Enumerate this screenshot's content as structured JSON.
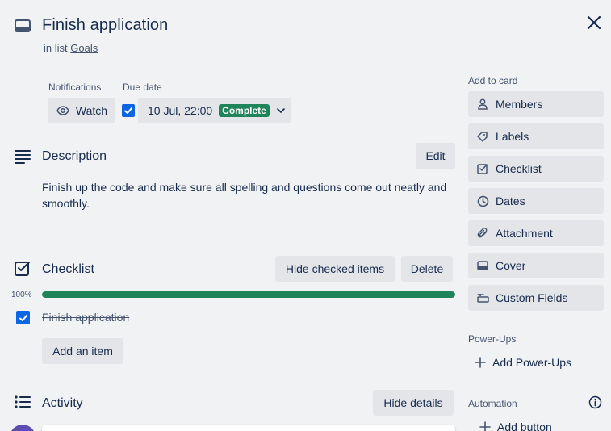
{
  "card": {
    "title": "Finish application",
    "in_list_prefix": "in list",
    "list_name": "Goals"
  },
  "notifications": {
    "label": "Notifications",
    "watch_label": "Watch"
  },
  "due_date": {
    "label": "Due date",
    "checked": true,
    "value": "10 Jul, 22:00",
    "status": "Complete",
    "status_color": "#1f845a"
  },
  "description": {
    "title": "Description",
    "edit_label": "Edit",
    "text": "Finish up the code and make sure all spelling and questions come out neatly and smoothly."
  },
  "checklist": {
    "title": "Checklist",
    "hide_checked_label": "Hide checked items",
    "delete_label": "Delete",
    "progress_text": "100%",
    "progress": 1.0,
    "items": [
      {
        "text": "Finish application",
        "checked": true
      }
    ],
    "add_item_label": "Add an item"
  },
  "activity": {
    "title": "Activity",
    "hide_details_label": "Hide details"
  },
  "sidebar": {
    "add_to_card_heading": "Add to card",
    "add_to_card": [
      {
        "label": "Members",
        "icon": "person-icon"
      },
      {
        "label": "Labels",
        "icon": "tag-icon"
      },
      {
        "label": "Checklist",
        "icon": "checklist-icon"
      },
      {
        "label": "Dates",
        "icon": "clock-icon"
      },
      {
        "label": "Attachment",
        "icon": "paperclip-icon"
      },
      {
        "label": "Cover",
        "icon": "cover-icon"
      },
      {
        "label": "Custom Fields",
        "icon": "custom-fields-icon"
      }
    ],
    "power_ups_heading": "Power-Ups",
    "add_power_ups_label": "Add Power-Ups",
    "automation_heading": "Automation",
    "add_button_label": "Add button"
  },
  "colors": {
    "accent_blue": "#0c66e4",
    "success_green": "#1f845a",
    "background": "#f1f2f4",
    "button_bg": "#e3e5e9"
  }
}
